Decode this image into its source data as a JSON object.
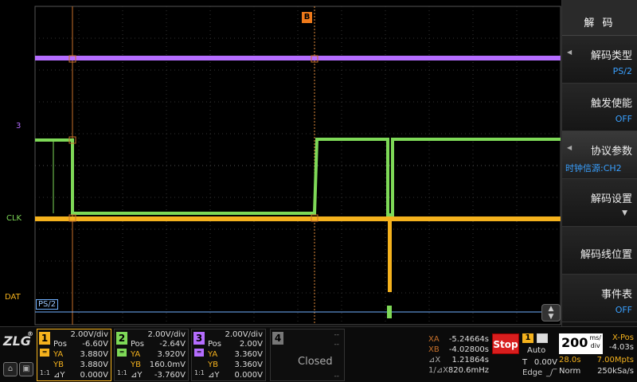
{
  "screen": {
    "trigger_marker": "B",
    "channel_labels": {
      "ch3": "3",
      "clk": "CLK",
      "dat": "DAT"
    },
    "decode_label": "PS/2"
  },
  "menu": {
    "title": "解 码",
    "items": [
      {
        "label": "解码类型",
        "value": "PS/2"
      },
      {
        "label": "触发使能",
        "value": "OFF"
      },
      {
        "label": "协议参数",
        "value": "时钟信源:CH2"
      },
      {
        "label": "解码设置",
        "value": ""
      },
      {
        "label": "解码线位置",
        "value": ""
      },
      {
        "label": "事件表",
        "value": "OFF"
      }
    ]
  },
  "channels": [
    {
      "num": "1",
      "color": "#f5b21d",
      "div": "2.00V/div",
      "pos_label": "Pos",
      "pos": "-6.60V",
      "ya_label": "YA",
      "ya": "3.880V",
      "yb_label": "YB",
      "yb": "3.880V",
      "dy_label": "⊿Y",
      "dy": "0.000V",
      "ratio": "1:1"
    },
    {
      "num": "2",
      "color": "#7ed957",
      "div": "2.00V/div",
      "pos_label": "Pos",
      "pos": "-2.64V",
      "ya_label": "YA",
      "ya": "3.920V",
      "yb_label": "YB",
      "yb": "160.0mV",
      "dy_label": "⊿Y",
      "dy": "-3.760V",
      "ratio": "1:1"
    },
    {
      "num": "3",
      "color": "#b56dff",
      "div": "2.00V/div",
      "pos_label": "Pos",
      "pos": "2.00V",
      "ya_label": "YA",
      "ya": "3.360V",
      "yb_label": "YB",
      "yb": "3.360V",
      "dy_label": "⊿Y",
      "dy": "0.000V",
      "ratio": "1:1"
    },
    {
      "num": "4",
      "status": "Closed",
      "dash": "--"
    }
  ],
  "cursors": {
    "xa_label": "XA",
    "xa": "-5.24664s",
    "xb_label": "XB",
    "xb": "-4.02800s",
    "dx_label": "⊿X",
    "dx": "1.21864s",
    "inv_label": "1/⊿X",
    "inv": "820.6mHz"
  },
  "run": {
    "stop_label": "Stop"
  },
  "trigger": {
    "source": "1",
    "mode": "Auto",
    "t_label": "T",
    "level": "0.00V",
    "type": "Edge"
  },
  "timebase": {
    "scale": "200",
    "unit_top": "ms/",
    "unit_bottom": "div",
    "xpos_label": "X-Pos",
    "xpos": "-4.03s",
    "duration": "28.0s",
    "memory": "7.00Mpts",
    "acq_mode": "Norm",
    "sample_rate": "250kSa/s"
  },
  "colors": {
    "ch1": "#f5b21d",
    "ch2": "#7ed957",
    "ch3": "#b56dff",
    "cursor": "#c8702a",
    "accent": "#39a0ff"
  }
}
